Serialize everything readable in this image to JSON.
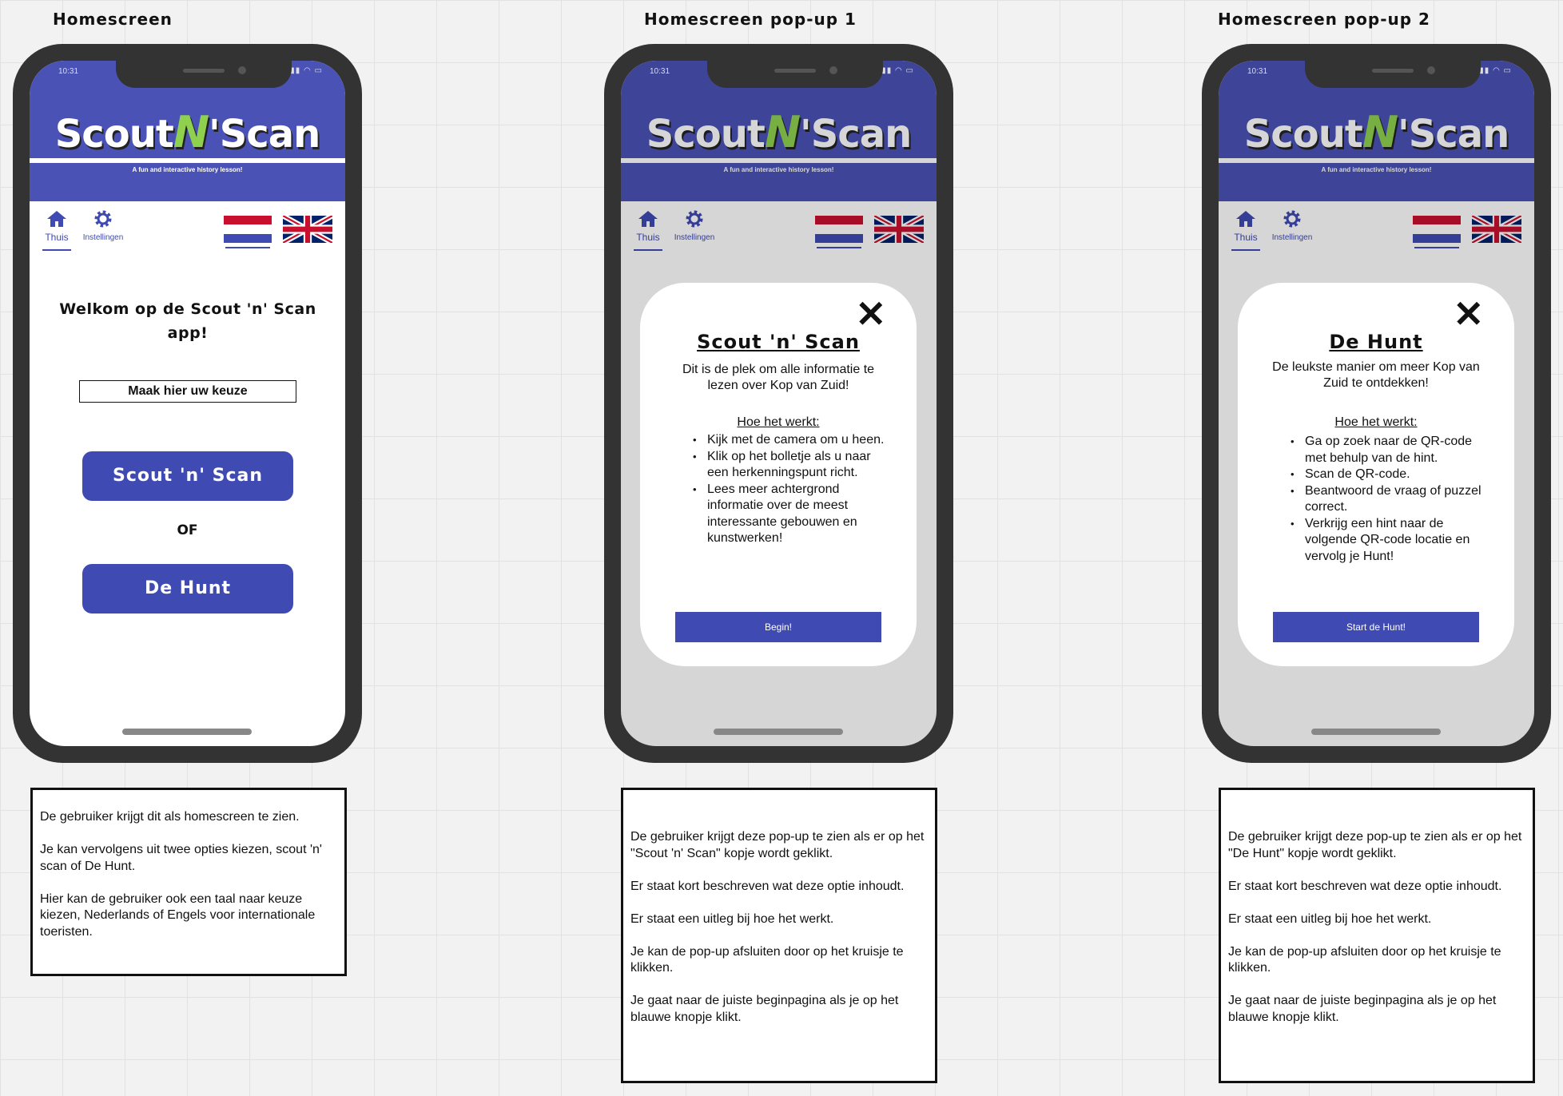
{
  "frames": [
    {
      "title": "Homescreen"
    },
    {
      "title": "Homescreen pop-up 1"
    },
    {
      "title": "Homescreen pop-up 2"
    }
  ],
  "phone": {
    "status_time": "10:31",
    "logo_part1": "Scout",
    "logo_n": "N",
    "logo_part2": "Scan",
    "logo_apostrophe": "'",
    "tagline": "A fun and interactive history lesson!",
    "nav_home_label": "Thuis",
    "nav_settings_label": "Instellingen",
    "icons": [
      "home-icon",
      "gear-icon",
      "netherlands-flag-icon",
      "uk-flag-icon",
      "close-icon"
    ],
    "colors": {
      "brand_blue": "#3f4ab3",
      "header_blue": "#4a53b5",
      "logo_green": "#8fd14f"
    }
  },
  "home": {
    "welcome": "Welkom op de Scout 'n' Scan app!",
    "choice_label": "Maak hier uw keuze",
    "scout_button": "Scout 'n' Scan",
    "or_label": "OF",
    "hunt_button": "De Hunt"
  },
  "popup1": {
    "title": "Scout 'n' Scan",
    "intro": "Dit is de plek om alle informatie te lezen over Kop van Zuid!",
    "how_label": "Hoe het werkt:",
    "steps": [
      "Kijk met de camera om u heen.",
      "Klik op het bolletje als u naar een herkenningspunt richt.",
      "Lees meer achtergrond informatie over de meest interessante gebouwen en kunstwerken!"
    ],
    "button": "Begin!"
  },
  "popup2": {
    "title": "De Hunt",
    "intro": "De leukste manier om meer Kop van Zuid te ontdekken!",
    "how_label": "Hoe het werkt:",
    "steps": [
      "Ga op zoek naar de QR-code met behulp van de hint.",
      "Scan de QR-code.",
      "Beantwoord de vraag of puzzel correct.",
      "Verkrijg een hint naar de volgende QR-code locatie en vervolg je Hunt!"
    ],
    "button": "Start de Hunt!"
  },
  "descriptions": [
    {
      "paragraphs": [
        "De gebruiker krijgt dit als homescreen te zien.",
        "Je kan vervolgens uit twee opties kiezen, scout 'n' scan of De Hunt.",
        "Hier kan de gebruiker ook een taal naar keuze kiezen, Nederlands of Engels voor internationale toeristen."
      ]
    },
    {
      "paragraphs": [
        "De gebruiker krijgt deze pop-up te zien als er op het \"Scout 'n' Scan\" kopje wordt geklikt.",
        "Er staat kort beschreven wat deze optie inhoudt.",
        "Er staat een uitleg bij hoe het werkt.",
        "Je kan de pop-up afsluiten door op het kruisje te klikken.",
        "Je gaat naar de juiste beginpagina als je op het blauwe knopje klikt."
      ]
    },
    {
      "paragraphs": [
        "De gebruiker krijgt deze pop-up te zien als er op het \"De Hunt\" kopje wordt geklikt.",
        "Er staat kort beschreven wat deze optie inhoudt.",
        "Er staat een uitleg bij hoe het werkt.",
        "Je kan de pop-up afsluiten door op het kruisje te klikken.",
        "Je gaat naar de juiste beginpagina als je op het blauwe knopje klikt."
      ]
    }
  ]
}
